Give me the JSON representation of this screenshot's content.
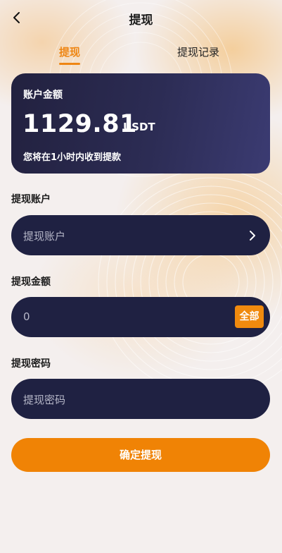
{
  "header": {
    "title": "提现",
    "back_icon": "back-arrow-icon"
  },
  "tabs": [
    {
      "label": "提现",
      "active": true
    },
    {
      "label": "提现记录",
      "active": false
    }
  ],
  "balance_card": {
    "label": "账户金额",
    "amount": "1129.81",
    "unit": "USDT",
    "note": "您将在1小时内收到提款"
  },
  "form": {
    "account": {
      "label": "提现账户",
      "placeholder": "提现账户",
      "icon": "chevron-right-icon"
    },
    "amount": {
      "label": "提现金额",
      "placeholder": "0",
      "all_button": "全部"
    },
    "password": {
      "label": "提现密码",
      "placeholder": "提现密码"
    }
  },
  "submit_label": "确定提现",
  "colors": {
    "accent": "#f08305",
    "card_bg": "#22213f",
    "field_bg": "#1f2142",
    "page_bg": "#f4efee"
  }
}
